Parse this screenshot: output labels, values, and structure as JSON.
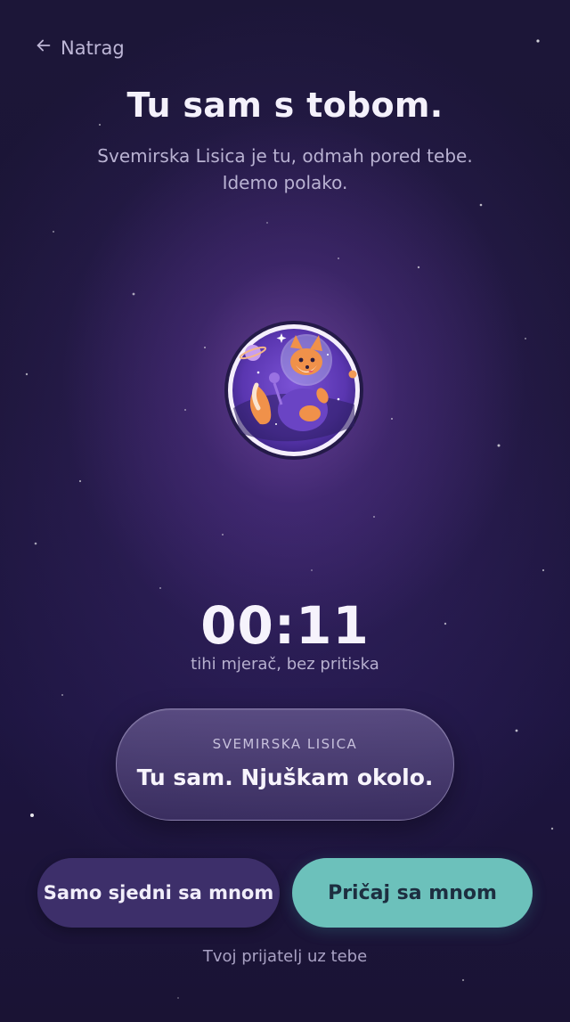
{
  "nav": {
    "back_label": "Natrag"
  },
  "header": {
    "title": "Tu sam s tobom.",
    "subtitle_line1": "Svemirska Lisica je tu, odmah pored tebe.",
    "subtitle_line2": "Idemo polako."
  },
  "companion": {
    "avatar_icon": "space-fox-astronaut-icon"
  },
  "timer": {
    "value": "00:11",
    "caption": "tihi mjerač, bez pritiska"
  },
  "message": {
    "speaker": "SVEMIRSKA LISICA",
    "text": "Tu sam. Njuškam okolo."
  },
  "actions": {
    "sit_label": "Samo sjedni sa mnom",
    "talk_label": "Pričaj sa mnom"
  },
  "footer": {
    "text": "Tvoj prijatelj uz tebe"
  },
  "colors": {
    "background": "#1c1638",
    "accent_teal": "#6cc1bb",
    "button_purple": "#3d2f6a"
  }
}
